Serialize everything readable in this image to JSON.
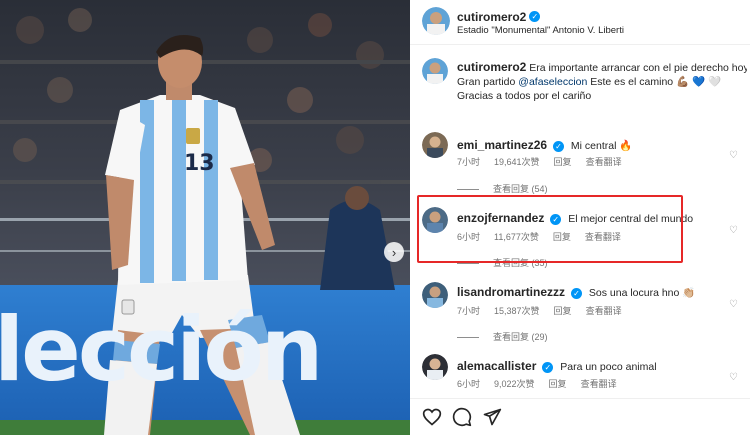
{
  "photo": {
    "jersey_number": "13",
    "banner_text": "lección",
    "next_icon": "chevron-right-icon"
  },
  "header": {
    "username": "cutiromero2",
    "location": "Estadio \"Monumental\" Antonio V. Liberti"
  },
  "caption": {
    "username": "cutiromero2",
    "line1": "Era importante arrancar con el pie derecho hoy .",
    "line2_prefix": "Gran partido ",
    "mention": "@afaseleccion",
    "line2_suffix": " Este es el camino 💪🏽 💙 🤍",
    "line3": "Gracias a todos por el cariño"
  },
  "comments": [
    {
      "username": "emi_martinez26",
      "text": "Mi central 🔥",
      "time": "7小时",
      "likes": "19,641次赞",
      "reply": "回复",
      "translate": "查看翻译",
      "view_replies": "查看回复 (54)"
    },
    {
      "username": "enzojfernandez",
      "text": "El mejor central del mundo",
      "time": "6小时",
      "likes": "11,677次赞",
      "reply": "回复",
      "translate": "查看翻译",
      "view_replies": "查看回复 (35)"
    },
    {
      "username": "lisandromartinezzz",
      "text": "Sos una locura hno 👏🏼",
      "time": "7小时",
      "likes": "15,387次赞",
      "reply": "回复",
      "translate": "查看翻译",
      "view_replies": "查看回复 (29)"
    },
    {
      "username": "alemacallister",
      "text": "Para un poco animal",
      "time": "6小时",
      "likes": "9,022次赞",
      "reply": "回复",
      "translate": "查看翻译"
    }
  ],
  "icons": {
    "verified": "✓",
    "like": "♡"
  },
  "colors": {
    "highlight": "#e62828",
    "verified": "#0095f6",
    "link": "#00376b",
    "jersey_blue": "#7cb6e6"
  }
}
